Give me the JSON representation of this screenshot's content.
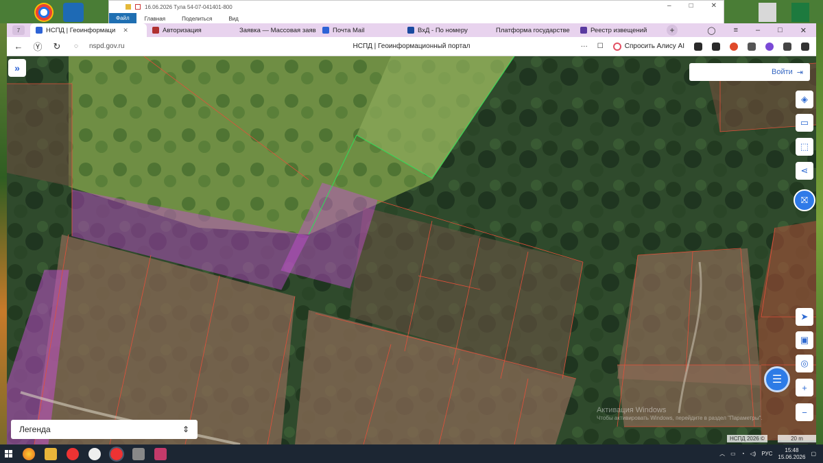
{
  "excel": {
    "title": "16.06.2026 Тула 54-07-041401-800",
    "tabs": [
      "Файл",
      "Главная",
      "Поделиться",
      "Вид"
    ]
  },
  "browser": {
    "tab_count": "7",
    "tabs": [
      {
        "label": "НСПД | Геоинформаци",
        "active": true,
        "icon_color": "#2d63d6"
      },
      {
        "label": "Авторизация",
        "active": false,
        "icon_color": "#b03030"
      },
      {
        "label": "Заявка — Массовая заяв",
        "active": false,
        "icon_color": "#2a8a3a"
      },
      {
        "label": "Почта Mail",
        "active": false,
        "icon_color": "#2d63d6"
      },
      {
        "label": "ВхД - По номеру",
        "active": false,
        "icon_color": "#1a4aa0"
      },
      {
        "label": "Платформа государстве",
        "active": false,
        "icon_color": "#5a3aa0"
      },
      {
        "label": "Реестр извещений",
        "active": false,
        "icon_color": "#5a3aa0"
      }
    ],
    "url": "nspd.gov.ru",
    "page_title": "НСПД | Геоинформационный портал",
    "alisa_label": "Спросить Алису AI"
  },
  "map": {
    "login_label": "Войти",
    "legend_label": "Легенда",
    "watermark_title": "Активация Windows",
    "watermark_sub": "Чтобы активировать Windows, перейдите в раздел \"Параметры\".",
    "copyright": "НСПД 2026 ©",
    "scale_label": "20 m",
    "tools_top": [
      "layers-icon",
      "ruler-icon",
      "select-area-icon",
      "share-icon",
      "cadastre-icon"
    ],
    "tools_bottom": [
      "locate-icon",
      "print-icon",
      "search-location-icon",
      "zoom-in-icon",
      "zoom-out-icon"
    ]
  },
  "taskbar": {
    "lang": "РУС",
    "time": "15:48",
    "date": "15.06.2026"
  },
  "colors": {
    "parcel_line": "#e4503a",
    "parcel_pink_fill": "#c94fd6",
    "parcel_green_line": "#2ee05a",
    "accent": "#2d63d6"
  }
}
